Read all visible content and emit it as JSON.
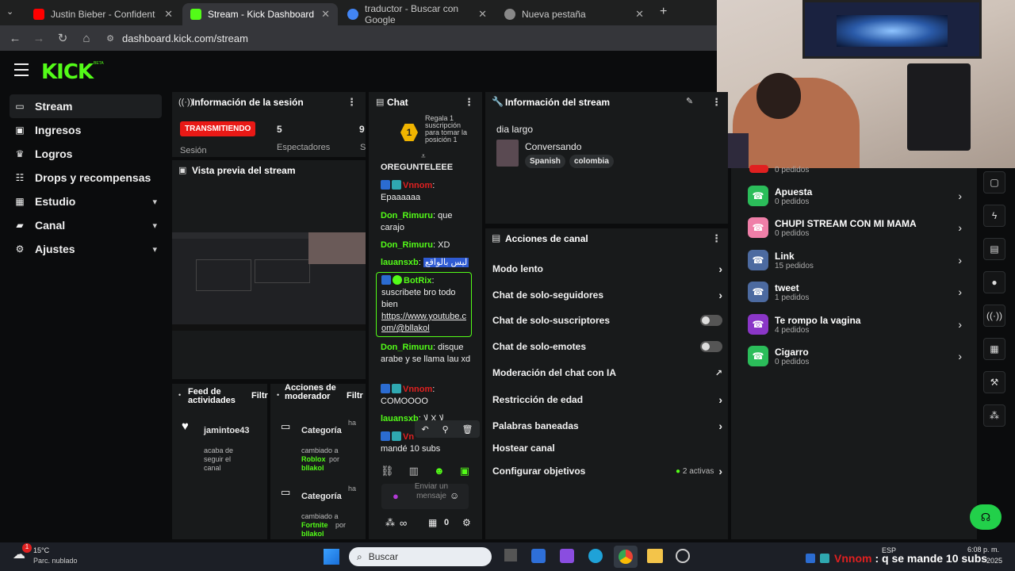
{
  "browser": {
    "tabs": [
      {
        "label": "Justin Bieber - Confident (Audi",
        "color": "#ff0000"
      },
      {
        "label": "Stream - Kick Dashboard",
        "color": "#53fc18"
      },
      {
        "label": "traductor - Buscar con Google",
        "color": "#4285f4"
      },
      {
        "label": "Nueva pestaña",
        "color": "#888888"
      }
    ],
    "url": "dashboard.kick.com/stream",
    "new_tab": "+"
  },
  "brand": {
    "logo": "KICK",
    "beta": "BETA",
    "accent": "#53fc18"
  },
  "sidebar": {
    "items": [
      {
        "label": "Stream",
        "icon": "stream-icon"
      },
      {
        "label": "Ingresos",
        "icon": "money-icon"
      },
      {
        "label": "Logros",
        "icon": "trophy-icon"
      },
      {
        "label": "Drops y recompensas",
        "icon": "gift-icon"
      },
      {
        "label": "Estudio",
        "icon": "studio-icon",
        "chev": "▾"
      },
      {
        "label": "Canal",
        "icon": "channel-icon",
        "chev": "▾"
      },
      {
        "label": "Ajustes",
        "icon": "gear-icon",
        "chev": "▾"
      }
    ]
  },
  "session": {
    "title": "Información de la sesión",
    "status": "TRANSMITIENDO",
    "session_value": "5",
    "session_label": "Sesión",
    "viewers_value": "9",
    "viewers_label": "Espectadores",
    "extra_label": "S"
  },
  "preview": {
    "title": "Vista previa del stream"
  },
  "feed": {
    "title": "Feed de actividades",
    "filter": "Filtr",
    "user": "jamintoe43",
    "event": "acaba de seguir el canal"
  },
  "modactions": {
    "title": "Acciones de moderador",
    "filter": "Filtr",
    "entries": [
      {
        "label": "Categoría",
        "ago": "ha",
        "line1": "cambiado a",
        "game": "Roblox",
        "by": "por",
        "user": "blIakol"
      },
      {
        "label": "Categoría",
        "ago": "ha",
        "line1": "cambiado a",
        "game": "Fortnite",
        "by": "por",
        "user": "blIakol"
      }
    ]
  },
  "chat": {
    "title": "Chat",
    "gift": {
      "rank": "1",
      "text": "Regala 1 suscripción para tomar la posición 1"
    },
    "messages": [
      {
        "user": "",
        "text": "OREGUNTELEEE",
        "user_color": "#53fc18"
      },
      {
        "user": "Vnnom",
        "text": "Epaaaaaa",
        "user_color": "#e02020"
      },
      {
        "user": "Don_Rimuru",
        "text": "que carajo",
        "user_color": "#53fc18"
      },
      {
        "user": "Don_Rimuru",
        "text": "XD",
        "user_color": "#53fc18"
      },
      {
        "user": "lauansxb",
        "text": "ليس بالواقع",
        "user_color": "#53fc18"
      },
      {
        "user": "BotRix",
        "text": "suscribete bro todo bien",
        "link": "https://www.youtube.com/@bllakol",
        "user_color": "#53fc18"
      },
      {
        "user": "Don_Rimuru",
        "text": "disque arabe y se llama lau xd",
        "user_color": "#53fc18"
      },
      {
        "user": "Vnnom",
        "text": "COMOOOO",
        "user_color": "#e02020"
      },
      {
        "user": "lauansxb",
        "text": "لا X لا",
        "user_color": "#53fc18"
      },
      {
        "user": "Vn",
        "text": "mandé 10 subs",
        "user_color": "#e02020"
      }
    ],
    "input_placeholder": "Enviar un mensaje",
    "points": "0",
    "infinity": "∞"
  },
  "stream_info": {
    "title": "Información del stream",
    "stream_title": "dia largo",
    "category": "Conversando",
    "tags": [
      "Spanish",
      "colombia"
    ]
  },
  "channel_actions": {
    "title": "Acciones de canal",
    "items": [
      {
        "label": "Modo lento",
        "ctl": "arrow"
      },
      {
        "label": "Chat de solo-seguidores",
        "ctl": "arrow"
      },
      {
        "label": "Chat de solo-suscriptores",
        "ctl": "toggle"
      },
      {
        "label": "Chat de solo-emotes",
        "ctl": "toggle"
      },
      {
        "label": "Moderación del chat con IA",
        "ctl": "external"
      },
      {
        "label": "Restricción de edad",
        "ctl": "arrow"
      },
      {
        "label": "Palabras baneadas",
        "ctl": "arrow"
      },
      {
        "label": "Hostear canal",
        "ctl": "none"
      },
      {
        "label": "Configurar objetivos",
        "ctl": "arrow",
        "status": "2 activas"
      }
    ]
  },
  "rewards": {
    "top_partial": "0 pedidos",
    "items": [
      {
        "title": "Apuesta",
        "sub": "0 pedidos",
        "color": "#2bbd5a"
      },
      {
        "title": "CHUPI STREAM CON MI MAMA",
        "sub": "0 pedidos",
        "color": "#ef7fa8"
      },
      {
        "title": "Link",
        "sub": "15 pedidos",
        "color": "#4c6aa0"
      },
      {
        "title": "tweet",
        "sub": "1 pedidos",
        "color": "#4c6aa0"
      },
      {
        "title": "Te rompo la vagina",
        "sub": "4 pedidos",
        "color": "#8a36c7"
      },
      {
        "title": "Cigarro",
        "sub": "0 pedidos",
        "color": "#2bbd5a"
      }
    ]
  },
  "taskbar": {
    "temp": "15°C",
    "weather": "Parc. nublado",
    "search": "Buscar",
    "lang": "ESP",
    "time": "6:08 p. m.",
    "date": "2025",
    "overlay": "Vnnom",
    "overlay_msg": ": q se mande 10 subs",
    "notif": "1"
  }
}
